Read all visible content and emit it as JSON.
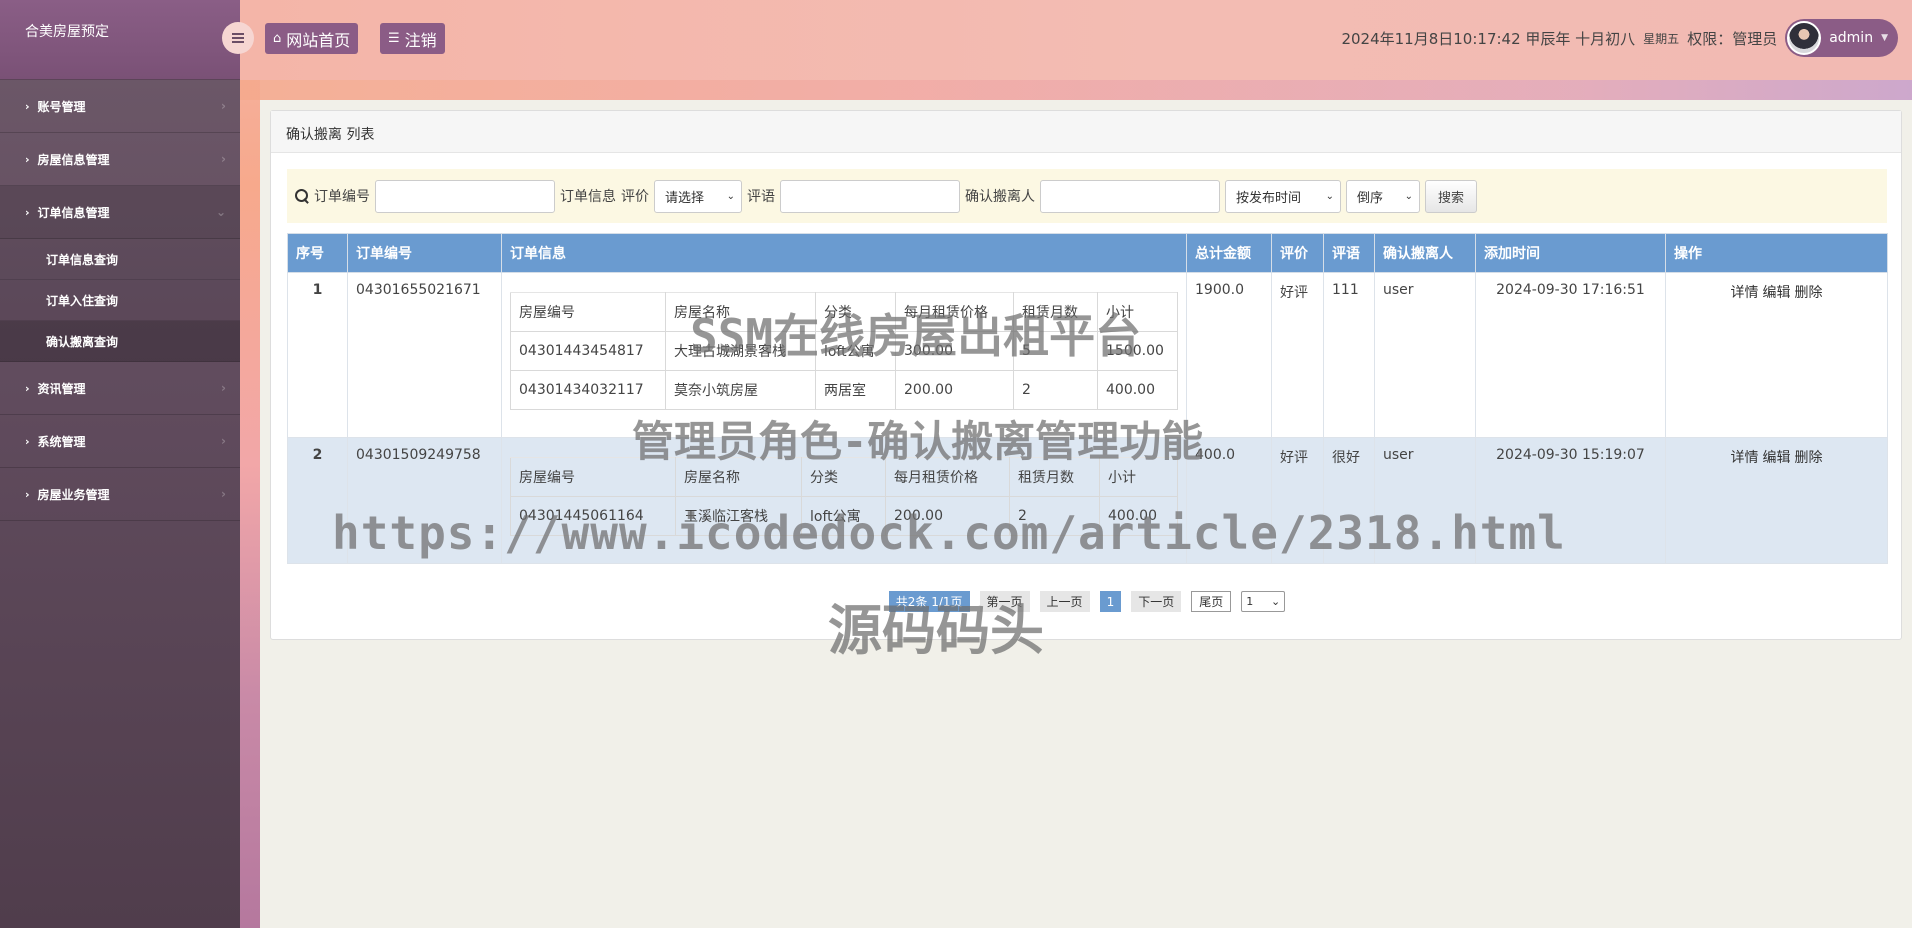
{
  "app": {
    "brand": "合美房屋预定"
  },
  "sidebar": {
    "items": [
      {
        "label": "账号管理"
      },
      {
        "label": "房屋信息管理"
      },
      {
        "label": "订单信息管理",
        "open": true,
        "children": [
          {
            "label": "订单信息查询"
          },
          {
            "label": "订单入住查询"
          },
          {
            "label": "确认搬离查询",
            "active": true
          }
        ]
      },
      {
        "label": "资讯管理"
      },
      {
        "label": "系统管理"
      },
      {
        "label": "房屋业务管理"
      }
    ]
  },
  "header": {
    "home_label": "网站首页",
    "logout_label": "注销",
    "datetime": "2024年11月8日10:17:42 甲辰年 十月初八",
    "weekday": "星期五",
    "role_label": "权限：管理员",
    "username": "admin"
  },
  "panel": {
    "title": "确认搬离 列表"
  },
  "search": {
    "order_no_label": "订单编号",
    "order_info_label": "订单信息",
    "rating_label": "评价",
    "rating_value": "请选择",
    "comment_label": "评语",
    "mover_label": "确认搬离人",
    "sort_field": "按发布时间",
    "sort_order": "倒序",
    "search_button": "搜索"
  },
  "table": {
    "headers": [
      "序号",
      "订单编号",
      "订单信息",
      "总计金额",
      "评价",
      "评语",
      "确认搬离人",
      "添加时间",
      "操作"
    ],
    "sub_headers": [
      "房屋编号",
      "房屋名称",
      "分类",
      "每月租赁价格",
      "租赁月数",
      "小计"
    ],
    "rows": [
      {
        "index": "1",
        "order_no": "04301655021671",
        "items": [
          [
            "04301443454817",
            "大理古城湖景客栈",
            "loft公寓",
            "300.00",
            "5",
            "1500.00"
          ],
          [
            "04301434032117",
            "莫奈小筑房屋",
            "两居室",
            "200.00",
            "2",
            "400.00"
          ]
        ],
        "total": "1900.0",
        "rating": "好评",
        "comment": "111",
        "mover": "user",
        "time": "2024-09-30 17:16:51"
      },
      {
        "index": "2",
        "order_no": "04301509249758",
        "items": [
          [
            "04301445061164",
            "玉溪临江客栈",
            "loft公寓",
            "200.00",
            "2",
            "400.00"
          ]
        ],
        "total": "400.0",
        "rating": "好评",
        "comment": "很好",
        "mover": "user",
        "time": "2024-09-30 15:19:07"
      }
    ],
    "ops": [
      "详情",
      "编辑",
      "删除"
    ]
  },
  "pagination": {
    "info": "共2条 1/1页",
    "first": "第一页",
    "prev": "上一页",
    "current": "1",
    "next": "下一页",
    "last": "尾页",
    "select_value": "1"
  },
  "watermarks": {
    "line1": "SSM在线房屋出租平台",
    "line2": "管理员角色-确认搬离管理功能",
    "line3": "https://www.icodedock.com/article/2318.html",
    "line4": "源码码头"
  },
  "colors": {
    "sidebar": "#614c5e",
    "accent": "#8b5c86",
    "table_header": "#6a9bd0",
    "search_bg": "#fcf8e3"
  }
}
